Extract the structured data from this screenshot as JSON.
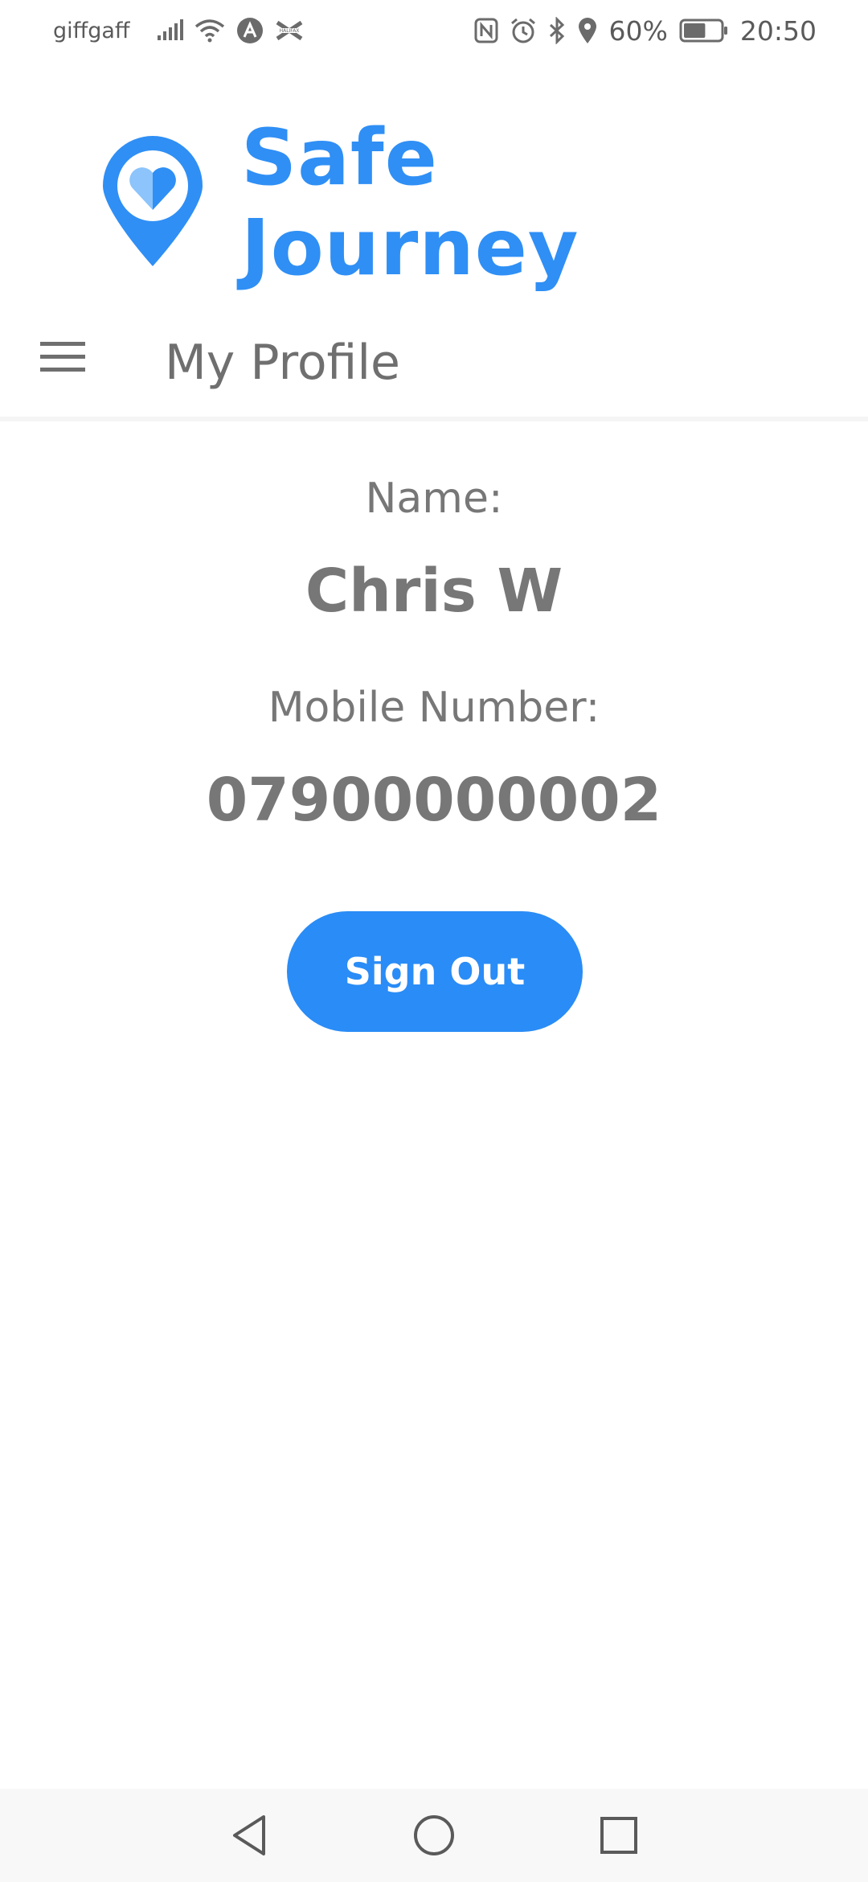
{
  "status_bar": {
    "carrier": "giffgaff",
    "battery_percent": "60%",
    "time": "20:50",
    "icons": [
      "signal-icon",
      "wifi-icon",
      "app-notification-icon",
      "halifax-icon",
      "nfc-icon",
      "alarm-icon",
      "bluetooth-icon",
      "location-icon",
      "battery-icon"
    ],
    "battery_level": 0.6
  },
  "brand": {
    "app_name": "Safe Journey",
    "logo_icon": "heart-location-pin-icon",
    "brand_color": "#2f8ff5"
  },
  "app_bar": {
    "menu_icon": "hamburger-menu-icon",
    "title": "My Profile"
  },
  "profile": {
    "name_label": "Name:",
    "name_value": "Chris W",
    "mobile_label": "Mobile Number:",
    "mobile_value": "07900000002"
  },
  "actions": {
    "sign_out_label": "Sign Out",
    "sign_out_color": "#2a8cf6"
  },
  "nav_bar": {
    "back_icon": "back-triangle-icon",
    "home_icon": "home-circle-icon",
    "recent_icon": "recent-apps-square-icon"
  }
}
